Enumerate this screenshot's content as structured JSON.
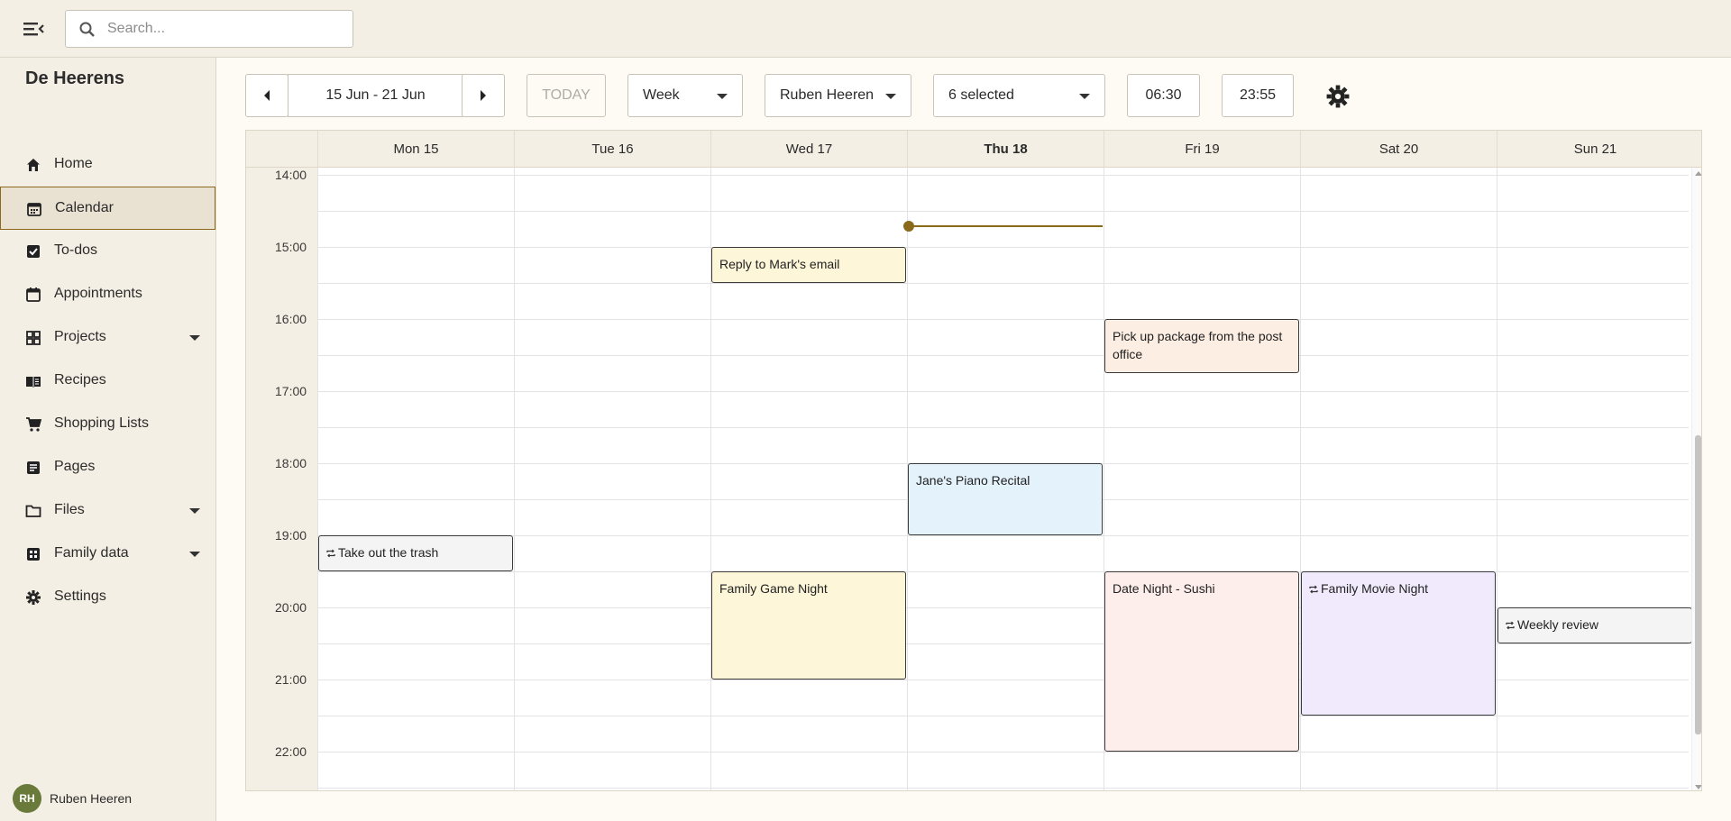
{
  "search": {
    "placeholder": "Search..."
  },
  "brand": "De Heerens",
  "sidebar": {
    "items": [
      {
        "label": "Home"
      },
      {
        "label": "Calendar"
      },
      {
        "label": "To-dos"
      },
      {
        "label": "Appointments"
      },
      {
        "label": "Projects"
      },
      {
        "label": "Recipes"
      },
      {
        "label": "Shopping Lists"
      },
      {
        "label": "Pages"
      },
      {
        "label": "Files"
      },
      {
        "label": "Family data"
      },
      {
        "label": "Settings"
      }
    ],
    "active": "Calendar"
  },
  "user": {
    "initials": "RH",
    "name": "Ruben Heeren",
    "avatar_color": "#6a7a3a"
  },
  "toolbar": {
    "date_range": "15 Jun - 21 Jun",
    "today": "TODAY",
    "view": "Week",
    "person": "Ruben Heeren",
    "calendars": "6 selected",
    "start_time": "06:30",
    "end_time": "23:55"
  },
  "calendar": {
    "days": [
      "Mon 15",
      "Tue 16",
      "Wed 17",
      "Thu 18",
      "Fri 19",
      "Sat 20",
      "Sun 21"
    ],
    "today": "Thu 18",
    "hours": [
      "14:00",
      "15:00",
      "16:00",
      "17:00",
      "18:00",
      "19:00",
      "20:00",
      "21:00",
      "22:00"
    ],
    "events": [
      {
        "title": "Reply to Mark's email",
        "day": "Wed 17",
        "start": "15:00",
        "end": "15:30",
        "color": "#fdf6d9",
        "recurring": false
      },
      {
        "title": "Pick up package from the post office",
        "day": "Fri 19",
        "start": "16:00",
        "end": "16:45",
        "color": "#fdeee3",
        "recurring": false
      },
      {
        "title": "Jane's Piano Recital",
        "day": "Thu 18",
        "start": "18:00",
        "end": "19:00",
        "color": "#e4f2fc",
        "recurring": false
      },
      {
        "title": "Take out the trash",
        "day": "Mon 15",
        "start": "19:00",
        "end": "19:30",
        "color": "#f4f4f4",
        "recurring": true
      },
      {
        "title": "Family Game Night",
        "day": "Wed 17",
        "start": "19:30",
        "end": "21:00",
        "color": "#fdf6d9",
        "recurring": false
      },
      {
        "title": "Date Night - Sushi",
        "day": "Fri 19",
        "start": "19:30",
        "end": "22:00",
        "color": "#fdeeeb",
        "recurring": false
      },
      {
        "title": "Family Movie Night",
        "day": "Sat 20",
        "start": "19:30",
        "end": "21:30",
        "color": "#f1eafc",
        "recurring": true
      },
      {
        "title": "Weekly review",
        "day": "Sun 21",
        "start": "20:00",
        "end": "20:30",
        "color": "#f4f4f4",
        "recurring": true
      }
    ]
  },
  "colors": {
    "accent": "#8a6a1a",
    "sidebar_bg": "#f4efe4",
    "page_bg": "#fdfbf3"
  }
}
